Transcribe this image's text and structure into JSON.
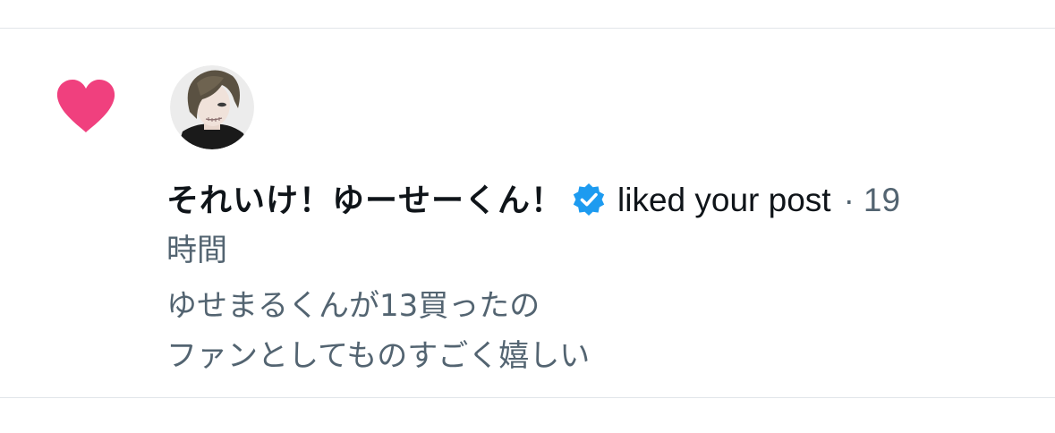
{
  "notification": {
    "type_icon": "heart-icon",
    "user": {
      "display_name": "それいけ！ゆーせーくん！",
      "verified": true,
      "avatar": "user-avatar"
    },
    "action": "liked your post",
    "separator": "·",
    "time_value": "19",
    "time_unit": "時間",
    "post_text": {
      "line1": "ゆせまるくんが13買ったの",
      "line2": "ファンとしてものすごく嬉しい"
    }
  },
  "colors": {
    "heart": "#f0407e",
    "verified_badge": "#1d9bf0",
    "primary_text": "#0f1419",
    "secondary_text": "#536471",
    "divider": "#e1e5e9"
  }
}
